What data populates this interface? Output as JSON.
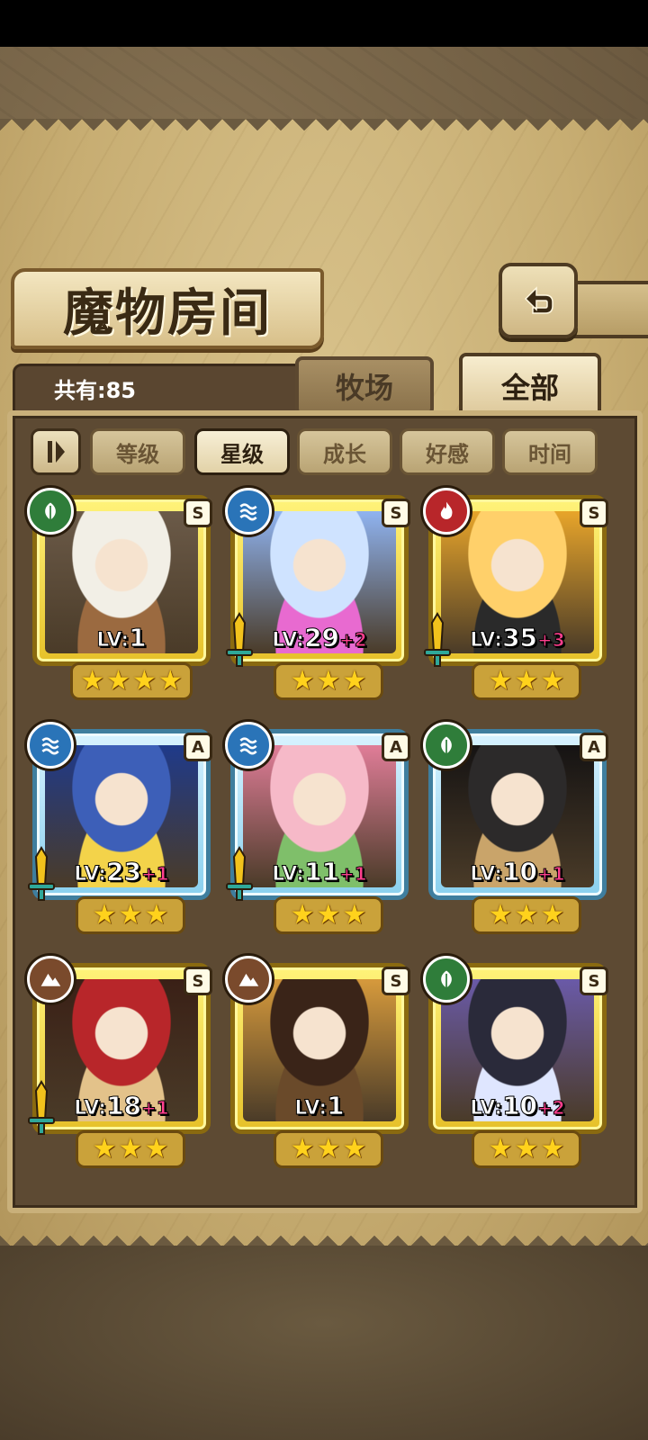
{
  "header": {
    "title": "魔物房间",
    "count_text": "共有:85",
    "tabs": [
      {
        "label": "牧场",
        "active": false
      },
      {
        "label": "全部",
        "active": true
      }
    ]
  },
  "filters": [
    {
      "label": "等级",
      "selected": false
    },
    {
      "label": "星级",
      "selected": true
    },
    {
      "label": "成长",
      "selected": false
    },
    {
      "label": "好感",
      "selected": false
    },
    {
      "label": "时间",
      "selected": false
    }
  ],
  "monsters": [
    {
      "element": "grass",
      "rank": "S",
      "frame": "gold",
      "level_prefix": "LV:",
      "level": "1",
      "bonus": "",
      "stars": 4,
      "has_sword": false
    },
    {
      "element": "water",
      "rank": "S",
      "frame": "gold",
      "level_prefix": "LV:",
      "level": "29",
      "bonus": "+2",
      "stars": 3,
      "has_sword": true
    },
    {
      "element": "fire",
      "rank": "S",
      "frame": "gold",
      "level_prefix": "LV:",
      "level": "35",
      "bonus": "+3",
      "stars": 3,
      "has_sword": true
    },
    {
      "element": "water",
      "rank": "A",
      "frame": "blue",
      "level_prefix": "LV:",
      "level": "23",
      "bonus": "+1",
      "stars": 3,
      "has_sword": true
    },
    {
      "element": "water",
      "rank": "A",
      "frame": "blue",
      "level_prefix": "LV:",
      "level": "11",
      "bonus": "+1",
      "stars": 3,
      "has_sword": true
    },
    {
      "element": "grass",
      "rank": "A",
      "frame": "blue",
      "level_prefix": "LV:",
      "level": "10",
      "bonus": "+1",
      "stars": 3,
      "has_sword": false
    },
    {
      "element": "earth",
      "rank": "S",
      "frame": "gold",
      "level_prefix": "LV:",
      "level": "18",
      "bonus": "+1",
      "stars": 3,
      "has_sword": true
    },
    {
      "element": "earth",
      "rank": "S",
      "frame": "gold",
      "level_prefix": "LV:",
      "level": "1",
      "bonus": "",
      "stars": 3,
      "has_sword": false
    },
    {
      "element": "grass",
      "rank": "S",
      "frame": "gold",
      "level_prefix": "LV:",
      "level": "10",
      "bonus": "+2",
      "stars": 3,
      "has_sword": false
    }
  ],
  "colors": {
    "gold_frame": "#e6c12a",
    "blue_frame": "#8ad0ee",
    "bonus_pink": "#ff3f8e",
    "star_yellow": "#ffd21c"
  },
  "icons": {
    "back": "return-arrow-icon",
    "sort_toggle": "sort-order-icon",
    "element_grass": "leaf-icon",
    "element_water": "water-waves-icon",
    "element_fire": "flame-icon",
    "element_earth": "mountain-icon",
    "equip": "sword-icon"
  }
}
